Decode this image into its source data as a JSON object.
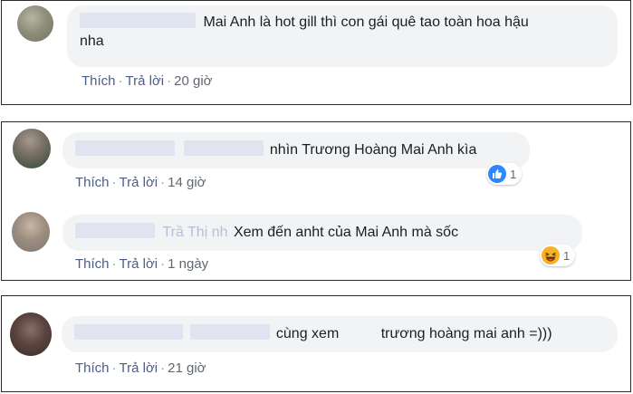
{
  "comments": [
    {
      "text_line1": "Mai Anh là hot gill thì con gái quê tao toàn hoa hậu",
      "text_line2": "nha",
      "like_label": "Thích",
      "reply_label": "Trả lời",
      "time": "20 giờ"
    },
    {
      "text": "nhìn Trương Hoàng Mai Anh kìa",
      "like_label": "Thích",
      "reply_label": "Trả lời",
      "time": "14 giờ",
      "reaction": {
        "icon": "like-icon",
        "count": "1",
        "color": "#2d88ff"
      }
    },
    {
      "name_partial": "Trầ    Thị     nh",
      "text": "Xem đến anht của Mai Anh mà sốc",
      "like_label": "Thích",
      "reply_label": "Trả lời",
      "time": "1 ngày",
      "reaction": {
        "icon": "haha-icon",
        "count": "1",
        "color": "#f7b125"
      }
    },
    {
      "text_a": "cùng xem",
      "text_b": "trương hoàng mai anh =)))",
      "like_label": "Thích",
      "reply_label": "Trả lời",
      "time": "21 giờ"
    }
  ]
}
